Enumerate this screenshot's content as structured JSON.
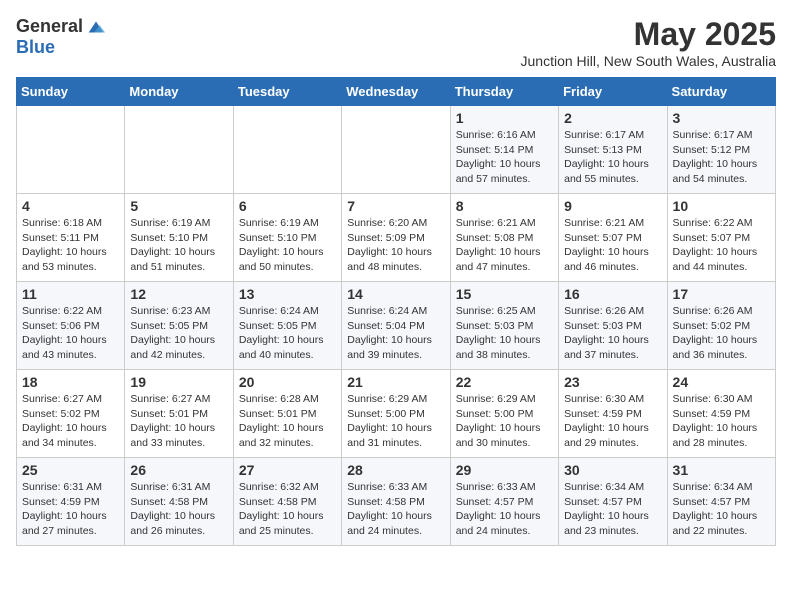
{
  "logo": {
    "general": "General",
    "blue": "Blue"
  },
  "title": "May 2025",
  "location": "Junction Hill, New South Wales, Australia",
  "days_of_week": [
    "Sunday",
    "Monday",
    "Tuesday",
    "Wednesday",
    "Thursday",
    "Friday",
    "Saturday"
  ],
  "weeks": [
    [
      {
        "day": "",
        "info": ""
      },
      {
        "day": "",
        "info": ""
      },
      {
        "day": "",
        "info": ""
      },
      {
        "day": "",
        "info": ""
      },
      {
        "day": "1",
        "info": "Sunrise: 6:16 AM\nSunset: 5:14 PM\nDaylight: 10 hours\nand 57 minutes."
      },
      {
        "day": "2",
        "info": "Sunrise: 6:17 AM\nSunset: 5:13 PM\nDaylight: 10 hours\nand 55 minutes."
      },
      {
        "day": "3",
        "info": "Sunrise: 6:17 AM\nSunset: 5:12 PM\nDaylight: 10 hours\nand 54 minutes."
      }
    ],
    [
      {
        "day": "4",
        "info": "Sunrise: 6:18 AM\nSunset: 5:11 PM\nDaylight: 10 hours\nand 53 minutes."
      },
      {
        "day": "5",
        "info": "Sunrise: 6:19 AM\nSunset: 5:10 PM\nDaylight: 10 hours\nand 51 minutes."
      },
      {
        "day": "6",
        "info": "Sunrise: 6:19 AM\nSunset: 5:10 PM\nDaylight: 10 hours\nand 50 minutes."
      },
      {
        "day": "7",
        "info": "Sunrise: 6:20 AM\nSunset: 5:09 PM\nDaylight: 10 hours\nand 48 minutes."
      },
      {
        "day": "8",
        "info": "Sunrise: 6:21 AM\nSunset: 5:08 PM\nDaylight: 10 hours\nand 47 minutes."
      },
      {
        "day": "9",
        "info": "Sunrise: 6:21 AM\nSunset: 5:07 PM\nDaylight: 10 hours\nand 46 minutes."
      },
      {
        "day": "10",
        "info": "Sunrise: 6:22 AM\nSunset: 5:07 PM\nDaylight: 10 hours\nand 44 minutes."
      }
    ],
    [
      {
        "day": "11",
        "info": "Sunrise: 6:22 AM\nSunset: 5:06 PM\nDaylight: 10 hours\nand 43 minutes."
      },
      {
        "day": "12",
        "info": "Sunrise: 6:23 AM\nSunset: 5:05 PM\nDaylight: 10 hours\nand 42 minutes."
      },
      {
        "day": "13",
        "info": "Sunrise: 6:24 AM\nSunset: 5:05 PM\nDaylight: 10 hours\nand 40 minutes."
      },
      {
        "day": "14",
        "info": "Sunrise: 6:24 AM\nSunset: 5:04 PM\nDaylight: 10 hours\nand 39 minutes."
      },
      {
        "day": "15",
        "info": "Sunrise: 6:25 AM\nSunset: 5:03 PM\nDaylight: 10 hours\nand 38 minutes."
      },
      {
        "day": "16",
        "info": "Sunrise: 6:26 AM\nSunset: 5:03 PM\nDaylight: 10 hours\nand 37 minutes."
      },
      {
        "day": "17",
        "info": "Sunrise: 6:26 AM\nSunset: 5:02 PM\nDaylight: 10 hours\nand 36 minutes."
      }
    ],
    [
      {
        "day": "18",
        "info": "Sunrise: 6:27 AM\nSunset: 5:02 PM\nDaylight: 10 hours\nand 34 minutes."
      },
      {
        "day": "19",
        "info": "Sunrise: 6:27 AM\nSunset: 5:01 PM\nDaylight: 10 hours\nand 33 minutes."
      },
      {
        "day": "20",
        "info": "Sunrise: 6:28 AM\nSunset: 5:01 PM\nDaylight: 10 hours\nand 32 minutes."
      },
      {
        "day": "21",
        "info": "Sunrise: 6:29 AM\nSunset: 5:00 PM\nDaylight: 10 hours\nand 31 minutes."
      },
      {
        "day": "22",
        "info": "Sunrise: 6:29 AM\nSunset: 5:00 PM\nDaylight: 10 hours\nand 30 minutes."
      },
      {
        "day": "23",
        "info": "Sunrise: 6:30 AM\nSunset: 4:59 PM\nDaylight: 10 hours\nand 29 minutes."
      },
      {
        "day": "24",
        "info": "Sunrise: 6:30 AM\nSunset: 4:59 PM\nDaylight: 10 hours\nand 28 minutes."
      }
    ],
    [
      {
        "day": "25",
        "info": "Sunrise: 6:31 AM\nSunset: 4:59 PM\nDaylight: 10 hours\nand 27 minutes."
      },
      {
        "day": "26",
        "info": "Sunrise: 6:31 AM\nSunset: 4:58 PM\nDaylight: 10 hours\nand 26 minutes."
      },
      {
        "day": "27",
        "info": "Sunrise: 6:32 AM\nSunset: 4:58 PM\nDaylight: 10 hours\nand 25 minutes."
      },
      {
        "day": "28",
        "info": "Sunrise: 6:33 AM\nSunset: 4:58 PM\nDaylight: 10 hours\nand 24 minutes."
      },
      {
        "day": "29",
        "info": "Sunrise: 6:33 AM\nSunset: 4:57 PM\nDaylight: 10 hours\nand 24 minutes."
      },
      {
        "day": "30",
        "info": "Sunrise: 6:34 AM\nSunset: 4:57 PM\nDaylight: 10 hours\nand 23 minutes."
      },
      {
        "day": "31",
        "info": "Sunrise: 6:34 AM\nSunset: 4:57 PM\nDaylight: 10 hours\nand 22 minutes."
      }
    ]
  ]
}
